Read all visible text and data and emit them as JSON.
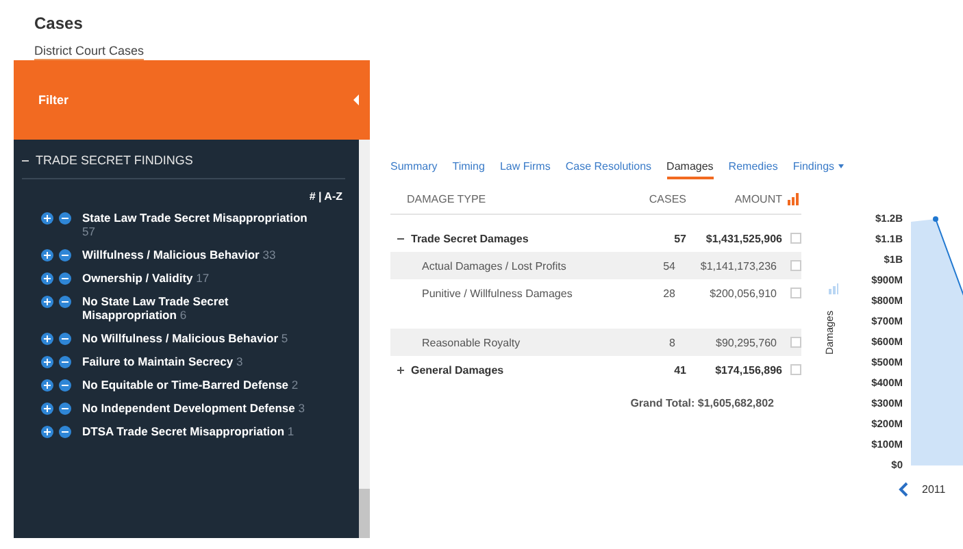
{
  "header": {
    "title": "Cases",
    "subtitle": "District Court Cases"
  },
  "filter": {
    "label": "Filter"
  },
  "sidebar": {
    "section": {
      "title": "TRADE SECRET FINDINGS",
      "expanded": true
    },
    "sort": "# | A-Z",
    "items": [
      {
        "label": "State Law Trade Secret Misappropriation",
        "count": "57"
      },
      {
        "label": "Willfulness / Malicious Behavior",
        "count": "33"
      },
      {
        "label": "Ownership / Validity",
        "count": "17"
      },
      {
        "label": "No State Law Trade Secret Misappropriation",
        "count": "6"
      },
      {
        "label": "No Willfulness / Malicious Behavior",
        "count": "5"
      },
      {
        "label": "Failure to Maintain Secrecy",
        "count": "3"
      },
      {
        "label": "No Equitable or Time-Barred Defense",
        "count": "2"
      },
      {
        "label": "No Independent Development Defense",
        "count": "3"
      },
      {
        "label": "DTSA Trade Secret Misappropriation",
        "count": "1"
      }
    ]
  },
  "tabs": [
    {
      "label": "Summary",
      "selected": false
    },
    {
      "label": "Timing",
      "selected": false
    },
    {
      "label": "Law Firms",
      "selected": false
    },
    {
      "label": "Case Resolutions",
      "selected": false
    },
    {
      "label": "Damages",
      "selected": true
    },
    {
      "label": "Remedies",
      "selected": false
    },
    {
      "label": "Findings",
      "selected": false,
      "dropdown": true
    }
  ],
  "table": {
    "columns": [
      "DAMAGE TYPE",
      "CASES",
      "AMOUNT"
    ],
    "rows": [
      {
        "kind": "group",
        "expanded": true,
        "type": "Trade Secret Damages",
        "cases": "57",
        "amount": "$1,431,525,906",
        "selected": false,
        "checked": false
      },
      {
        "kind": "item",
        "type": "Actual Damages / Lost Profits",
        "cases": "54",
        "amount": "$1,141,173,236",
        "selected": true,
        "checked": false
      },
      {
        "kind": "item",
        "type": "Punitive / Willfulness Damages",
        "cases": "28",
        "amount": "$200,056,910",
        "selected": false,
        "checked": false
      },
      {
        "kind": "item",
        "type": "Reasonable Royalty",
        "cases": "8",
        "amount": "$90,295,760",
        "selected": true,
        "checked": false
      },
      {
        "kind": "group",
        "expanded": false,
        "type": "General Damages",
        "cases": "41",
        "amount": "$174,156,896",
        "selected": false,
        "checked": false
      }
    ],
    "grand_total": "Grand Total: $1,605,682,802"
  },
  "chart": {
    "ylabel": "Damages",
    "x_label": "2011",
    "y_tick_labels": [
      "$1.2B",
      "$1.1B",
      "$1B",
      "$900M",
      "$800M",
      "$700M",
      "$600M",
      "$500M",
      "$400M",
      "$300M",
      "$200M",
      "$100M",
      "$0"
    ]
  }
}
